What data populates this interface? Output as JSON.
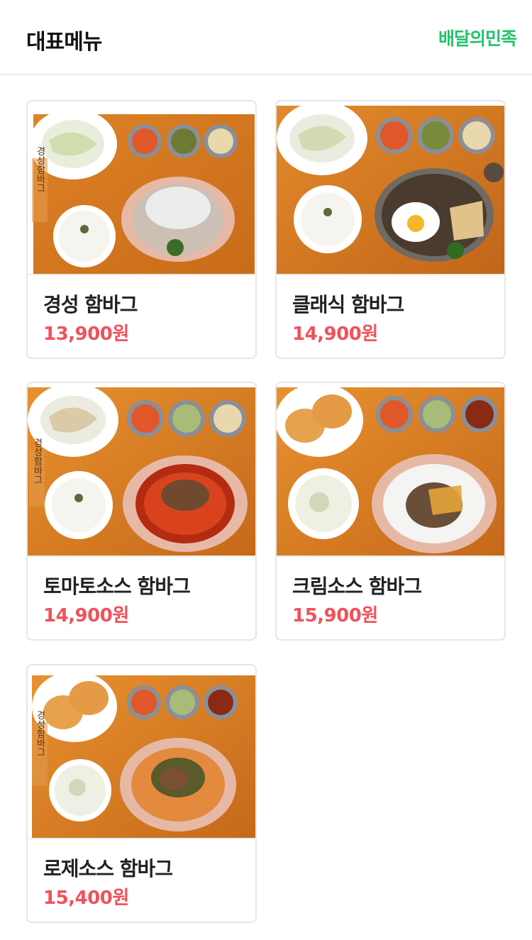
{
  "header": {
    "title": "대표메뉴",
    "brand": "배달의민족"
  },
  "menu": [
    {
      "name": "경성 함바그",
      "price": "13,900원",
      "stamp": "경성함바그"
    },
    {
      "name": "클래식 함바그",
      "price": "14,900원"
    },
    {
      "name": "토마토소스 함바그",
      "price": "14,900원",
      "stamp": "경성함바그"
    },
    {
      "name": "크림소스 함바그",
      "price": "15,900원"
    },
    {
      "name": "로제소스 함바그",
      "price": "15,400원",
      "stamp": "경성함바그"
    }
  ],
  "colors": {
    "brand": "#21c46b",
    "price": "#f0525b",
    "tray": "#d9791f"
  }
}
